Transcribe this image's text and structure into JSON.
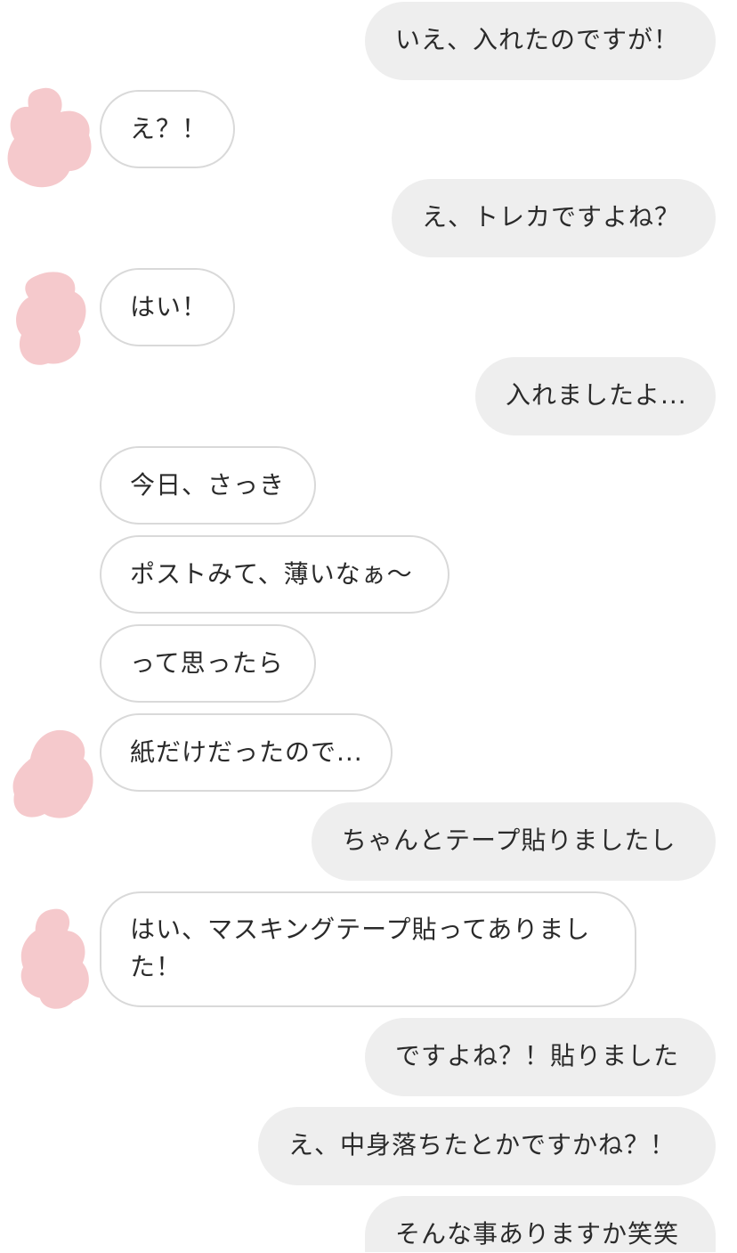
{
  "chat": {
    "messages": [
      {
        "side": "out",
        "text": "いえ、入れたのですが！"
      },
      {
        "side": "in",
        "text": "え？！"
      },
      {
        "side": "out",
        "text": "え、トレカですよね？"
      },
      {
        "side": "in",
        "text": "はい！"
      },
      {
        "side": "out",
        "text": "入れましたよ..."
      },
      {
        "side": "in",
        "text": "今日、さっき"
      },
      {
        "side": "in",
        "text": "ポストみて、薄いなぁ〜"
      },
      {
        "side": "in",
        "text": "って思ったら"
      },
      {
        "side": "in",
        "text": "紙だけだったので..."
      },
      {
        "side": "out",
        "text": "ちゃんとテープ貼りましたし"
      },
      {
        "side": "in",
        "text": "はい、マスキングテープ貼ってありました！"
      },
      {
        "side": "out",
        "text": "ですよね？！貼りました"
      },
      {
        "side": "out",
        "text": "え、中身落ちたとかですかね？！"
      },
      {
        "side": "out",
        "text": "そんな事ありますか笑笑"
      }
    ]
  },
  "colors": {
    "outgoing_bubble": "#eeeeee",
    "incoming_border": "#d9d9d9",
    "avatar_redaction": "#f5c9cc"
  }
}
